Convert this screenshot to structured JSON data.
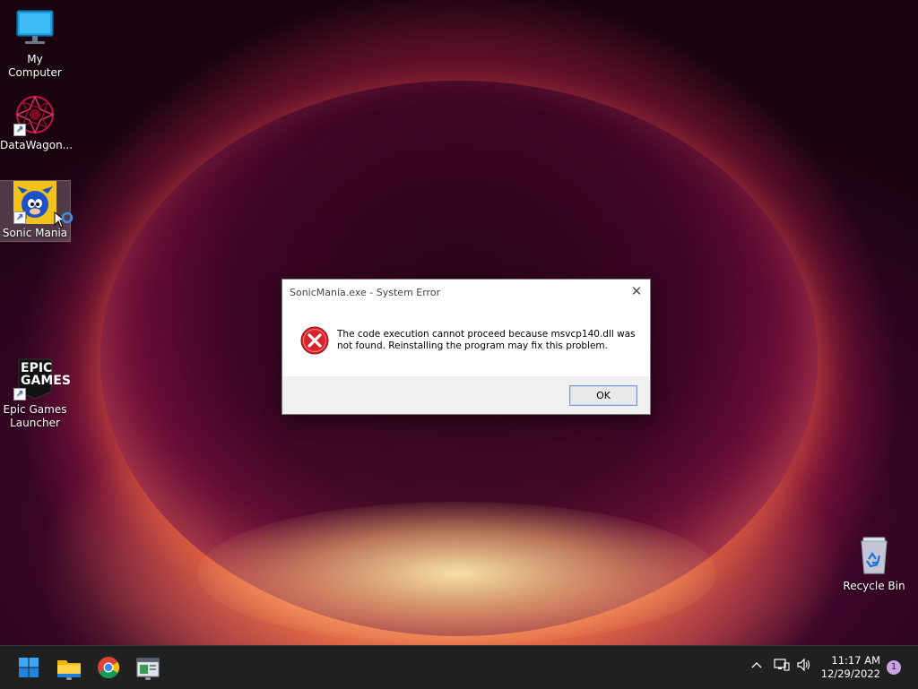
{
  "desktop": {
    "icons": [
      {
        "label": "My Computer",
        "icon": "monitor-icon"
      },
      {
        "label": "DataWagon...",
        "icon": "datawagon-icon"
      },
      {
        "label": "Sonic Mania",
        "icon": "sonic-mania-icon"
      },
      {
        "label": "Epic Games Launcher",
        "icon": "epic-games-icon",
        "logo_text": "EPIC GAMES"
      },
      {
        "label": "Recycle Bin",
        "icon": "recycle-bin-icon"
      }
    ],
    "shortcut_glyph": "↗"
  },
  "dialog": {
    "title": "SonicMania.exe - System Error",
    "close_glyph": "✕",
    "message": "The code execution cannot proceed because msvcp140.dll was not found. Reinstalling the program may fix this problem.",
    "ok_label": "OK",
    "icon": "error-icon"
  },
  "taskbar": {
    "apps": [
      {
        "name": "Start",
        "icon": "windows-start-icon"
      },
      {
        "name": "File Explorer",
        "icon": "file-explorer-icon"
      },
      {
        "name": "Google Chrome",
        "icon": "chrome-icon"
      },
      {
        "name": "Sonic Mania",
        "icon": "app-window-icon"
      }
    ],
    "tray": {
      "chevron": "^",
      "time": "11:17 AM",
      "date": "12/29/2022",
      "notification_count": "1"
    }
  },
  "colors": {
    "taskbar": "#202020",
    "accent": "#0078d4",
    "error_red": "#d8232a"
  }
}
